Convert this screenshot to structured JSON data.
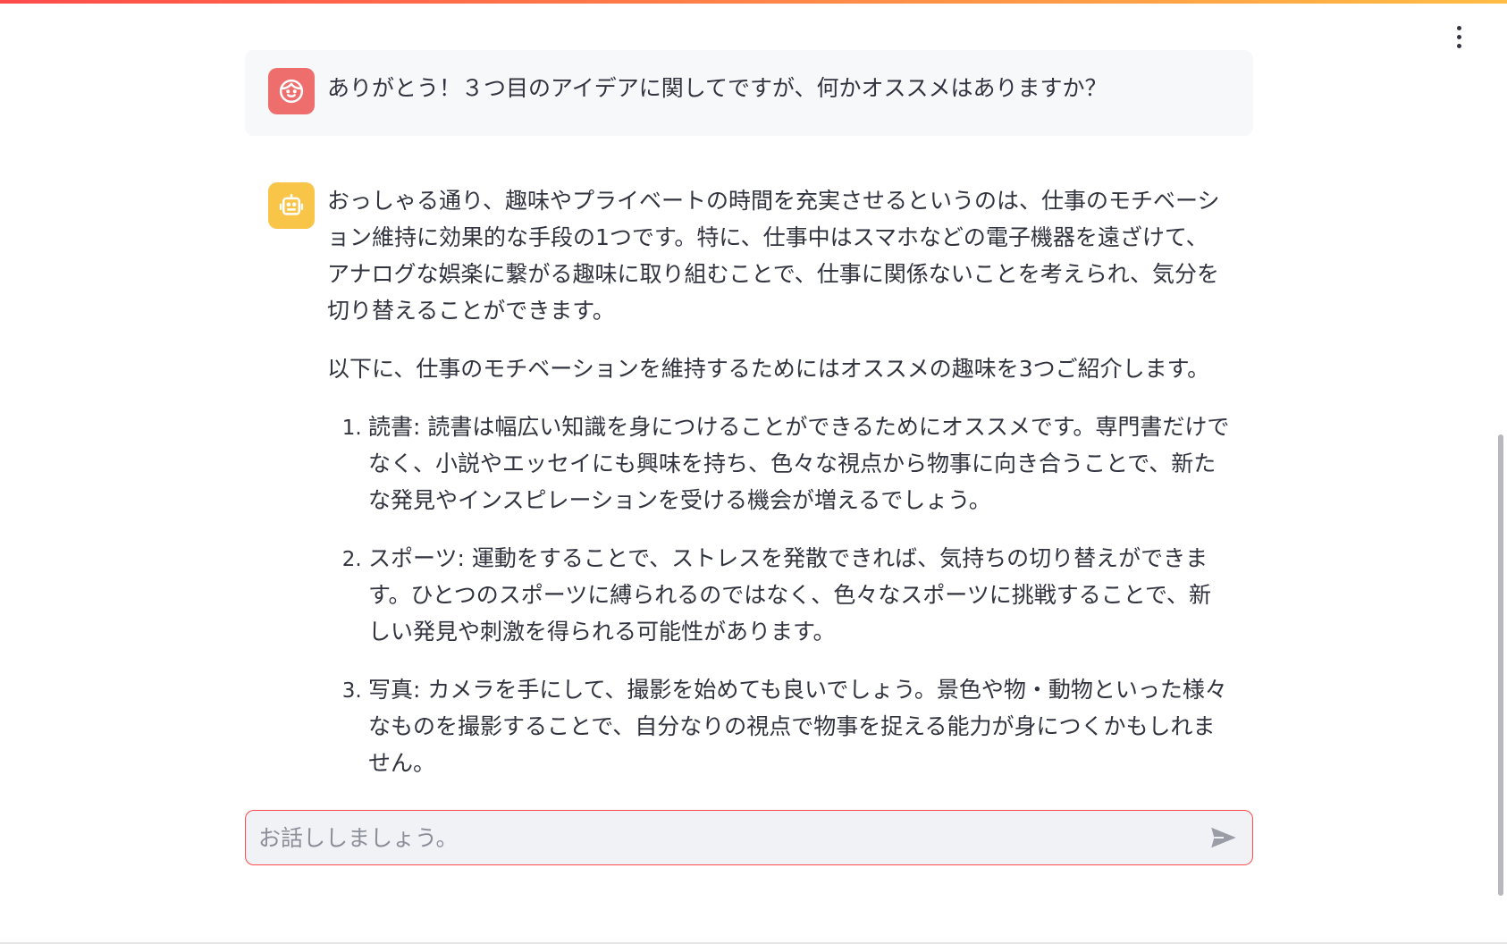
{
  "header": {
    "menu_icon": "vertical-ellipsis-icon"
  },
  "messages": [
    {
      "role": "user",
      "avatar_icon": "smiling-face-icon",
      "text": "ありがとう！３つ目のアイデアに関してですが、何かオススメはありますか？"
    },
    {
      "role": "assistant",
      "avatar_icon": "robot-icon",
      "paragraphs": [
        "おっしゃる通り、趣味やプライベートの時間を充実させるというのは、仕事のモチベーション維持に効果的な手段の1つです。特に、仕事中はスマホなどの電子機器を遠ざけて、アナログな娯楽に繋がる趣味に取り組むことで、仕事に関係ないことを考えられ、気分を切り替えることができます。",
        "以下に、仕事のモチベーションを維持するためにはオススメの趣味を3つご紹介します。"
      ],
      "list": [
        "読書: 読書は幅広い知識を身につけることができるためにオススメです。専門書だけでなく、小説やエッセイにも興味を持ち、色々な視点から物事に向き合うことで、新たな発見やインスピレーションを受ける機会が増えるでしょう。",
        "スポーツ: 運動をすることで、ストレスを発散できれば、気持ちの切り替えができます。ひとつのスポーツに縛られるのではなく、色々なスポーツに挑戦することで、新しい発見や刺激を得られる可能性があります。",
        "写真: カメラを手にして、撮影を始めても良いでしょう。景色や物・動物といった様々なものを撮影することで、自分なりの視点で物事を捉える能力が身につくかもしれません。"
      ]
    }
  ],
  "input": {
    "placeholder": "お話ししましょう。",
    "value": "",
    "send_icon": "send-arrow-icon"
  },
  "colors": {
    "accent": "#ff4b4b",
    "user_avatar": "#ee6e6e",
    "bot_avatar": "#f8c549",
    "user_message_bg": "#f7f8fa",
    "input_bg": "#f0f2f6",
    "text": "#31333f"
  }
}
